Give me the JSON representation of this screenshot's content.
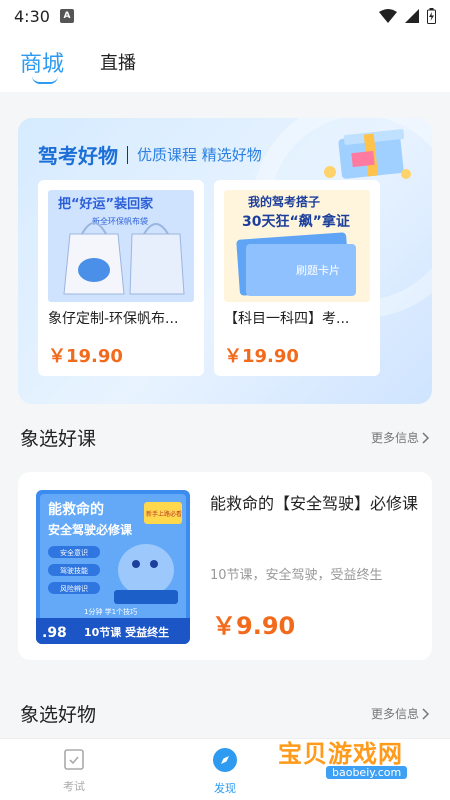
{
  "status": {
    "time": "4:30",
    "sim": "A"
  },
  "top_tabs": {
    "active": "商城",
    "other": "直播"
  },
  "hero": {
    "title": "驾考好物",
    "subtitle": "优质课程 精选好物",
    "products": [
      {
        "name": "象仔定制-环保帆布...",
        "price": "￥19.90"
      },
      {
        "name": "【科目一科四】考...",
        "price": "￥19.90"
      }
    ],
    "poster1": {
      "line": "把“好运”装回家",
      "sub": "新全环保帆布袋"
    },
    "poster2": {
      "line1": "我的驾考搭子",
      "line2": "30天狂“飙”拿证",
      "card": "刷题卡片"
    }
  },
  "course_section": {
    "title": "象选好课",
    "more": "更多信息",
    "course": {
      "title": "能救命的【安全驾驶】必修课",
      "desc": "10节课，安全驾驶，受益终生",
      "price": "￥9.90",
      "poster_title1": "能救命的",
      "poster_title2": "安全驾驶必修课",
      "poster_badge": "新手上路必看",
      "poster_items": [
        "安全意识",
        "驾驶技能",
        "风险辨识"
      ],
      "poster_tagline": "1分钟 学1个技巧",
      "poster_price": ".98",
      "poster_bottom": "10节课 受益终生"
    }
  },
  "goods_section": {
    "title": "象选好物",
    "more": "更多信息"
  },
  "bottom_nav": {
    "tab1": "考试",
    "tab2": "发现"
  },
  "watermark": {
    "text": "宝贝游戏网",
    "url": "baobeiy.com"
  },
  "colors": {
    "accent": "#2e9bf0",
    "price": "#f26a1b"
  }
}
